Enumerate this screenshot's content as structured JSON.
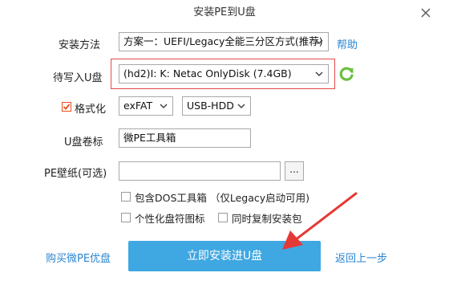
{
  "window": {
    "title": "安装PE到U盘"
  },
  "install_method": {
    "label": "安装方法",
    "value": "方案一：UEFI/Legacy全能三分区方式(推荐)",
    "help": "帮助"
  },
  "target_disk": {
    "label": "待写入U盘",
    "value": "(hd2)I: K: Netac OnlyDisk (7.4GB)"
  },
  "format": {
    "checkbox_label": "格式化",
    "checked": true,
    "filesystem": "exFAT",
    "mode": "USB-HDD"
  },
  "volume_label": {
    "label": "U盘卷标",
    "value": "微PE工具箱"
  },
  "wallpaper": {
    "label": "PE壁纸(可选)",
    "value": "",
    "browse": "..."
  },
  "options": {
    "dos_tools": {
      "label": "包含DOS工具箱 （仅Legacy启动可用)",
      "checked": false
    },
    "custom_icon": {
      "label": "个性化盘符图标",
      "checked": false
    },
    "copy_installer": {
      "label": "同时复制安装包",
      "checked": false
    }
  },
  "footer": {
    "buy": "购买微PE优盘",
    "install": "立即安装进U盘",
    "back": "返回上一步"
  },
  "colors": {
    "accent": "#3fa7e1",
    "link": "#2a86d1",
    "highlight_border": "#e44a4a",
    "arrow": "#e53935",
    "refresh": "#6cbf3f"
  },
  "icons": [
    "close-icon",
    "chevron-down-icon",
    "refresh-icon",
    "arrow-annotation"
  ]
}
